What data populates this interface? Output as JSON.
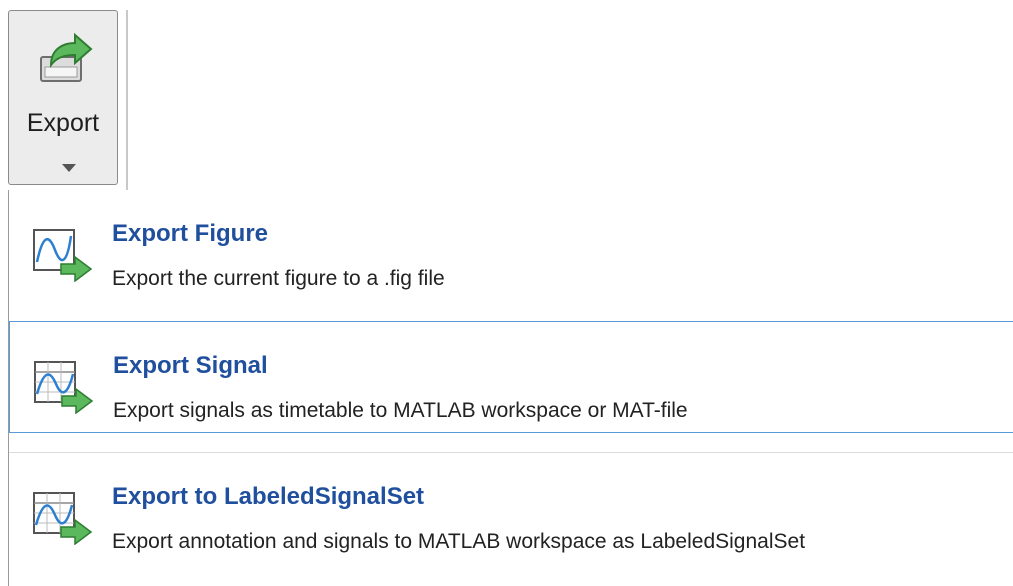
{
  "toolbar": {
    "export_label": "Export",
    "accent_color": "#1f4f9d"
  },
  "menu": {
    "items": [
      {
        "title": "Export Figure",
        "description": "Export the current figure to a .fig file",
        "icon": "export-figure-icon"
      },
      {
        "title": "Export Signal",
        "description": "Export signals as timetable to MATLAB workspace or MAT-file",
        "icon": "export-signal-icon"
      },
      {
        "title": "Export to LabeledSignalSet",
        "description": "Export annotation and signals to MATLAB workspace as LabeledSignalSet",
        "icon": "export-labeled-signal-set-icon"
      }
    ]
  }
}
